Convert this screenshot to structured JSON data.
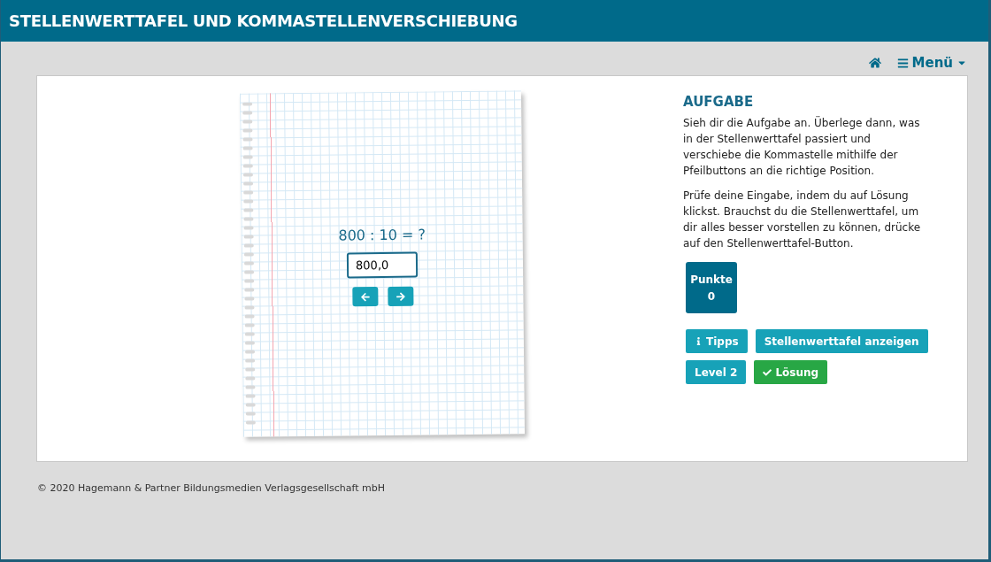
{
  "header": {
    "title": "STELLENWERTTAFEL UND KOMMASTELLENVERSCHIEBUNG"
  },
  "nav": {
    "menu_label": "Menü"
  },
  "exercise": {
    "equation": "800 : 10 = ?",
    "answer": "800,0"
  },
  "task": {
    "heading": "AUFGABE",
    "paragraphs": [
      "Sieh dir die Aufgabe an. Überlege dann, was in der Stellenwerttafel passiert und verschiebe die Kommastelle mithilfe der Pfeilbuttons an die richtige Position.",
      "Prüfe deine Eingabe, indem du auf Lösung klickst. Brauchst du die Stellenwerttafel, um dir alles besser vorstellen zu können, drücke auf den Stellenwerttafel-Button."
    ]
  },
  "score": {
    "label": "Punkte",
    "value": "0"
  },
  "buttons": [
    [
      {
        "label": "Tipps",
        "kind": "info"
      },
      {
        "label": "Stellenwerttafel anzeigen",
        "kind": "plain"
      }
    ],
    [
      {
        "label": "Level 2",
        "kind": "plain"
      },
      {
        "label": "Lösung",
        "kind": "check"
      }
    ]
  ],
  "footer": "© 2020 Hagemann & Partner Bildungsmedien Verlagsgesellschaft mbH"
}
